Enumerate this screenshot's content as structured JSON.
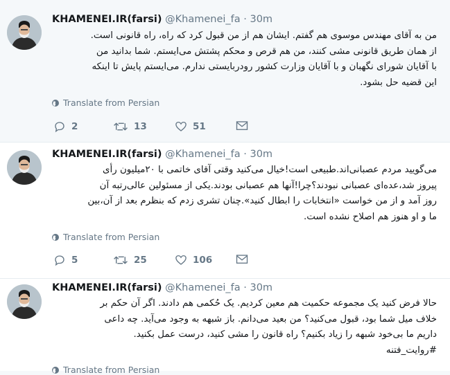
{
  "tweets": [
    {
      "name": "KHAMENEI.IR(farsi)",
      "handle": "@Khamenei_fa",
      "dot": "·",
      "time": "30m",
      "lines": [
        "من به آقای مهندس موسوی هم گفتم. ایشان هم از من قبول کرد که راه، راه قانونی است.",
        "از همان طریق قانونی مشی کنند، من هم قرص و محکم پشتش می‌ایستم. شما بدانید من",
        "با آقایان شورای نگهبان و با آقایان وزارت کشور رودربایستی ندارم. می‌ایستم پایش تا اینکه",
        "این قضیه حل بشود."
      ],
      "translate": "Translate from Persian",
      "replies": "2",
      "retweets": "13",
      "likes": "51"
    },
    {
      "name": "KHAMENEI.IR(farsi)",
      "handle": "@Khamenei_fa",
      "dot": "·",
      "time": "30m",
      "lines": [
        "می‌گویید مردم عصبانی‌اند.طبیعی است!خیال می‌کنید وقتی آقای خاتمی با ۲۰میلیون رأی",
        "پیروز شد،عده‌ای عصبانی نبودند؟چرا!آنها هم عصبانی بودند.یکی از مسئولین عالی‌رتبه آن",
        "روز آمد و از من خواست «انتخابات را ابطال کنید».چنان تشری زدم که بنظرم بعد از آن،بین",
        "ما و او هنوز هم اصلاح نشده است."
      ],
      "translate": "Translate from Persian",
      "replies": "5",
      "retweets": "25",
      "likes": "106"
    },
    {
      "name": "KHAMENEI.IR(farsi)",
      "handle": "@Khamenei_fa",
      "dot": "·",
      "time": "30m",
      "lines": [
        "حالا فرض کنید یک مجموعه حکمیت هم معین کردیم. یک حُکمی هم دادند. اگر آن حکم بر",
        "خلاف میل شما بود، قبول می‌کنید؟ من بعید می‌دانم. باز شبهه به وجود می‌آید. چه داعی",
        "داریم ما بی‌خود شبهه را زیاد بکنیم؟ راه قانون را مشی کنید، درست عمل بکنید."
      ],
      "hashtag": "#روایت_فتنه",
      "translate": "Translate from Persian"
    }
  ],
  "colors": {
    "highlight_bg": "#f5f8fa",
    "muted": "#657786",
    "thread_line": "#ccd6dd"
  },
  "icons": {
    "reply": "reply-icon",
    "retweet": "retweet-icon",
    "like": "heart-icon",
    "dm": "envelope-icon",
    "globe": "globe-icon"
  }
}
